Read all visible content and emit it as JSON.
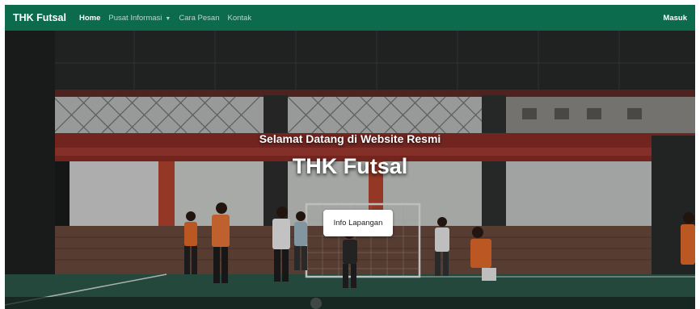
{
  "navbar": {
    "brand": "THK Futsal",
    "links": [
      {
        "label": "Home"
      },
      {
        "label": "Pusat Informasi"
      },
      {
        "label": "Cara Pesan"
      },
      {
        "label": "Kontak"
      }
    ],
    "login": "Masuk",
    "color": "#0b6b4c"
  },
  "hero": {
    "subtitle": "Selamat Datang di Website Resmi",
    "title": "THK Futsal",
    "button": "Info Lapangan"
  }
}
